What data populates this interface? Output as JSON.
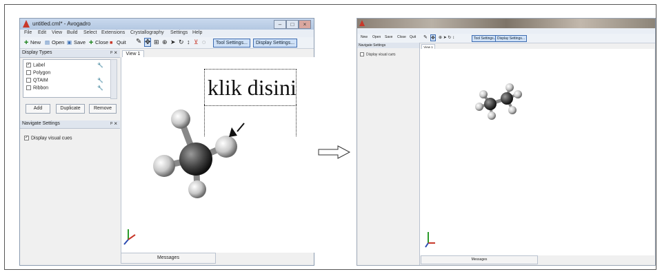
{
  "left_window": {
    "title": "untitled.cml* - Avogadro",
    "menu": [
      "File",
      "Edit",
      "View",
      "Build",
      "Select",
      "Extensions",
      "Crystallography",
      "Settings",
      "Help"
    ],
    "toolbar": {
      "new_label": "New",
      "open_label": "Open",
      "save_label": "Save",
      "close_label": "Close",
      "quit_label": "Quit",
      "tool_settings_label": "Tool Settings...",
      "display_settings_label": "Display Settings..."
    },
    "display_types": {
      "header": "Display Types",
      "items": [
        {
          "label": "Label",
          "checked": true
        },
        {
          "label": "Polygon",
          "checked": false
        },
        {
          "label": "QTAIM",
          "checked": false
        },
        {
          "label": "Ribbon",
          "checked": false
        }
      ],
      "add_label": "Add",
      "duplicate_label": "Duplicate",
      "remove_label": "Remove"
    },
    "navigate_settings": {
      "header": "Navigate Settings",
      "option_label": "Display visual cues",
      "option_checked": true
    },
    "view_tab_label": "View 1",
    "messages_tab_label": "Messages",
    "annotation": "klik disini"
  },
  "right_window": {
    "toolbar": {
      "new_label": "New",
      "open_label": "Open",
      "save_label": "Save",
      "close_label": "Close",
      "quit_label": "Quit",
      "tool_settings_label": "Tool Settings...",
      "display_settings_label": "Display Settings..."
    },
    "side_header": "Navigate Settings",
    "side_option": "Display visual cues",
    "view_tab_label": "View 1",
    "messages_tab_label": "Messages"
  },
  "colors": {
    "selection_blue": "#3c6bb0",
    "atom_carbon": "#555555",
    "atom_hydrogen": "#d8d8d8"
  }
}
